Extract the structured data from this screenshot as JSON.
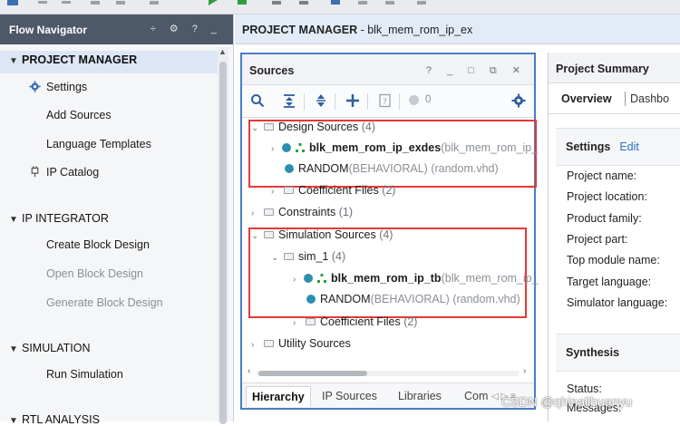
{
  "flow_navigator": {
    "title": "Flow Navigator",
    "controls": "÷ ⚙ ? _",
    "sections": [
      {
        "label": "PROJECT MANAGER",
        "items": [
          "Settings",
          "Add Sources",
          "Language Templates",
          "IP Catalog"
        ]
      },
      {
        "label": "IP INTEGRATOR",
        "items": [
          "Create Block Design",
          "Open Block Design",
          "Generate Block Design"
        ]
      },
      {
        "label": "SIMULATION",
        "items": [
          "Run Simulation"
        ]
      },
      {
        "label": "RTL ANALYSIS"
      }
    ]
  },
  "main_header": {
    "title": "PROJECT MANAGER",
    "subtitle": " - blk_mem_rom_ip_ex"
  },
  "sources": {
    "title": "Sources",
    "controls": "? _ □ ⧉ ✕",
    "error_count": "0",
    "tree": {
      "design_sources": {
        "label": "Design Sources",
        "count": "(4)"
      },
      "top1": {
        "name": "blk_mem_rom_ip_exdes",
        "detail": "(blk_mem_rom_ip_"
      },
      "random1": {
        "name": "RANDOM",
        "type": "(BEHAVIORAL)",
        "file": " (random.vhd)"
      },
      "coef1": {
        "label": "Coefficient Files",
        "count": "(2)"
      },
      "constraints": {
        "label": "Constraints",
        "count": "(1)"
      },
      "sim_sources": {
        "label": "Simulation Sources",
        "count": "(4)"
      },
      "sim_1": {
        "label": "sim_1",
        "count": "(4)"
      },
      "top2": {
        "name": "blk_mem_rom_ip_tb",
        "detail": "(blk_mem_rom_ip_"
      },
      "random2": {
        "name": "RANDOM",
        "type": "(BEHAVIORAL)",
        "file": " (random.vhd)"
      },
      "coef2": {
        "label": "Coefficient Files",
        "count": "(2)"
      },
      "utility": {
        "label": "Utility Sources"
      }
    },
    "tabs": [
      "Hierarchy",
      "IP Sources",
      "Libraries",
      "Com"
    ],
    "tab_nav": "◁ ▷ ≡"
  },
  "summary": {
    "title": "Project Summary",
    "tab_overview": "Overview",
    "tab_dashboard": "Dashbo",
    "settings_label": "Settings",
    "edit_label": "Edit",
    "fields": [
      "Project name:",
      "Project location:",
      "Product family:",
      "Project part:",
      "Top module name:",
      "Target language:",
      "Simulator language:"
    ],
    "synthesis_label": "Synthesis",
    "status_label": "Status:",
    "messages_label": "Messages:"
  },
  "watermark": "CSDN @qhinalihuanyu",
  "colors": {
    "accent": "#4a7cc6",
    "highlight": "#e53935",
    "nav_header": "#4d5868",
    "dot": "#2b8fb0"
  }
}
